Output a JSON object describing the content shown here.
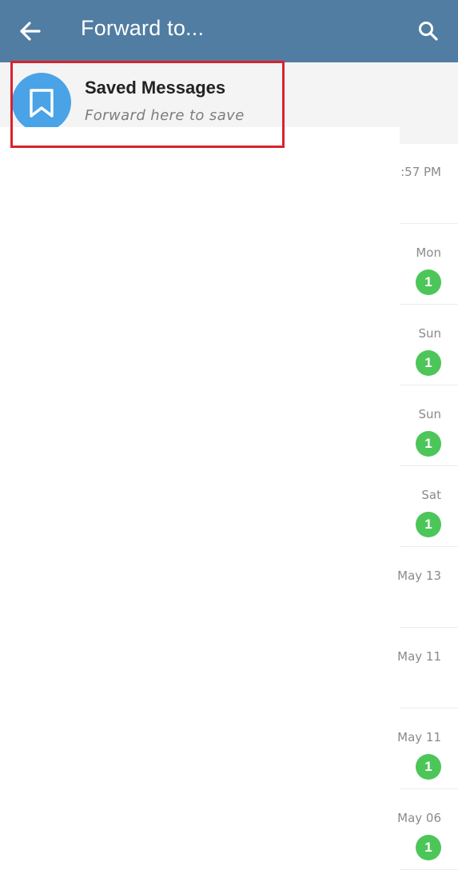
{
  "header": {
    "title": "Forward to...",
    "back_icon": "arrow-left-icon",
    "search_icon": "search-icon"
  },
  "saved": {
    "title": "Saved Messages",
    "subtitle": "Forward here to save",
    "icon": "bookmark-icon",
    "avatar_color": "#4aa3e6"
  },
  "highlight_color": "#d9232e",
  "badge_color": "#4cc659",
  "chats": [
    {
      "time": ":57 PM",
      "badge": ""
    },
    {
      "time": "Mon",
      "badge": "1"
    },
    {
      "time": "Sun",
      "badge": "1"
    },
    {
      "time": "Sun",
      "badge": "1"
    },
    {
      "time": "Sat",
      "badge": "1"
    },
    {
      "time": "May 13",
      "badge": ""
    },
    {
      "time": "May 11",
      "badge": ""
    },
    {
      "time": "May 11",
      "badge": "1"
    },
    {
      "time": "May 06",
      "badge": "1"
    }
  ]
}
